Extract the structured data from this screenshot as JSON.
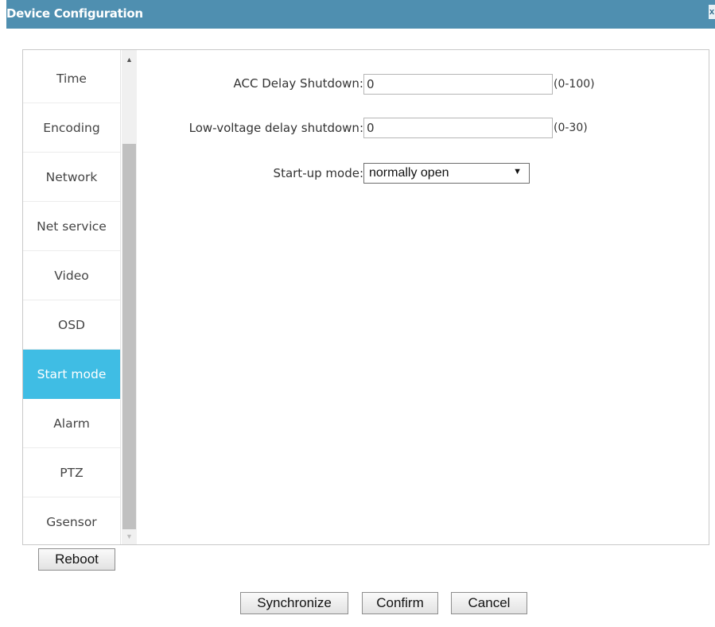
{
  "window": {
    "title": "Device Configuration",
    "close_label": "x"
  },
  "nav": {
    "items": [
      {
        "label": "Time"
      },
      {
        "label": "Encoding"
      },
      {
        "label": "Network"
      },
      {
        "label": "Net service"
      },
      {
        "label": "Video"
      },
      {
        "label": "OSD"
      },
      {
        "label": "Start mode",
        "active": true
      },
      {
        "label": "Alarm"
      },
      {
        "label": "PTZ"
      },
      {
        "label": "Gsensor"
      }
    ],
    "scroll_up": "▲",
    "scroll_down": "▼"
  },
  "form": {
    "acc_delay": {
      "label": "ACC Delay Shutdown:",
      "value": "0",
      "range": "(0-100)"
    },
    "low_voltage_delay": {
      "label": "Low-voltage delay shutdown:",
      "value": "0",
      "range": "(0-30)"
    },
    "startup_mode": {
      "label": "Start-up mode:",
      "selected": "normally open",
      "arrow": "▼"
    }
  },
  "buttons": {
    "reboot": "Reboot",
    "synchronize": "Synchronize",
    "confirm": "Confirm",
    "cancel": "Cancel"
  },
  "colors": {
    "titlebar": "#4f8fb0",
    "active_nav": "#3fbde4"
  }
}
